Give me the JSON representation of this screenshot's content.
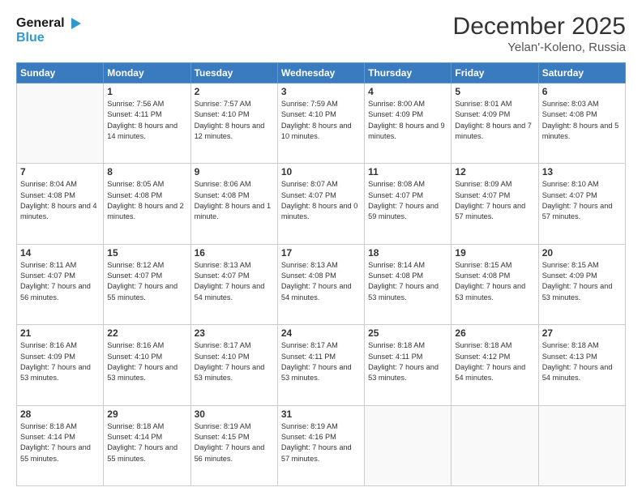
{
  "header": {
    "logo_line1": "General",
    "logo_line2": "Blue",
    "title": "December 2025",
    "location": "Yelan'-Koleno, Russia"
  },
  "weekdays": [
    "Sunday",
    "Monday",
    "Tuesday",
    "Wednesday",
    "Thursday",
    "Friday",
    "Saturday"
  ],
  "weeks": [
    [
      {
        "day": "",
        "empty": true
      },
      {
        "day": "1",
        "sunrise": "Sunrise: 7:56 AM",
        "sunset": "Sunset: 4:11 PM",
        "daylight": "Daylight: 8 hours and 14 minutes."
      },
      {
        "day": "2",
        "sunrise": "Sunrise: 7:57 AM",
        "sunset": "Sunset: 4:10 PM",
        "daylight": "Daylight: 8 hours and 12 minutes."
      },
      {
        "day": "3",
        "sunrise": "Sunrise: 7:59 AM",
        "sunset": "Sunset: 4:10 PM",
        "daylight": "Daylight: 8 hours and 10 minutes."
      },
      {
        "day": "4",
        "sunrise": "Sunrise: 8:00 AM",
        "sunset": "Sunset: 4:09 PM",
        "daylight": "Daylight: 8 hours and 9 minutes."
      },
      {
        "day": "5",
        "sunrise": "Sunrise: 8:01 AM",
        "sunset": "Sunset: 4:09 PM",
        "daylight": "Daylight: 8 hours and 7 minutes."
      },
      {
        "day": "6",
        "sunrise": "Sunrise: 8:03 AM",
        "sunset": "Sunset: 4:08 PM",
        "daylight": "Daylight: 8 hours and 5 minutes."
      }
    ],
    [
      {
        "day": "7",
        "sunrise": "Sunrise: 8:04 AM",
        "sunset": "Sunset: 4:08 PM",
        "daylight": "Daylight: 8 hours and 4 minutes."
      },
      {
        "day": "8",
        "sunrise": "Sunrise: 8:05 AM",
        "sunset": "Sunset: 4:08 PM",
        "daylight": "Daylight: 8 hours and 2 minutes."
      },
      {
        "day": "9",
        "sunrise": "Sunrise: 8:06 AM",
        "sunset": "Sunset: 4:08 PM",
        "daylight": "Daylight: 8 hours and 1 minute."
      },
      {
        "day": "10",
        "sunrise": "Sunrise: 8:07 AM",
        "sunset": "Sunset: 4:07 PM",
        "daylight": "Daylight: 8 hours and 0 minutes."
      },
      {
        "day": "11",
        "sunrise": "Sunrise: 8:08 AM",
        "sunset": "Sunset: 4:07 PM",
        "daylight": "Daylight: 7 hours and 59 minutes."
      },
      {
        "day": "12",
        "sunrise": "Sunrise: 8:09 AM",
        "sunset": "Sunset: 4:07 PM",
        "daylight": "Daylight: 7 hours and 57 minutes."
      },
      {
        "day": "13",
        "sunrise": "Sunrise: 8:10 AM",
        "sunset": "Sunset: 4:07 PM",
        "daylight": "Daylight: 7 hours and 57 minutes."
      }
    ],
    [
      {
        "day": "14",
        "sunrise": "Sunrise: 8:11 AM",
        "sunset": "Sunset: 4:07 PM",
        "daylight": "Daylight: 7 hours and 56 minutes."
      },
      {
        "day": "15",
        "sunrise": "Sunrise: 8:12 AM",
        "sunset": "Sunset: 4:07 PM",
        "daylight": "Daylight: 7 hours and 55 minutes."
      },
      {
        "day": "16",
        "sunrise": "Sunrise: 8:13 AM",
        "sunset": "Sunset: 4:07 PM",
        "daylight": "Daylight: 7 hours and 54 minutes."
      },
      {
        "day": "17",
        "sunrise": "Sunrise: 8:13 AM",
        "sunset": "Sunset: 4:08 PM",
        "daylight": "Daylight: 7 hours and 54 minutes."
      },
      {
        "day": "18",
        "sunrise": "Sunrise: 8:14 AM",
        "sunset": "Sunset: 4:08 PM",
        "daylight": "Daylight: 7 hours and 53 minutes."
      },
      {
        "day": "19",
        "sunrise": "Sunrise: 8:15 AM",
        "sunset": "Sunset: 4:08 PM",
        "daylight": "Daylight: 7 hours and 53 minutes."
      },
      {
        "day": "20",
        "sunrise": "Sunrise: 8:15 AM",
        "sunset": "Sunset: 4:09 PM",
        "daylight": "Daylight: 7 hours and 53 minutes."
      }
    ],
    [
      {
        "day": "21",
        "sunrise": "Sunrise: 8:16 AM",
        "sunset": "Sunset: 4:09 PM",
        "daylight": "Daylight: 7 hours and 53 minutes."
      },
      {
        "day": "22",
        "sunrise": "Sunrise: 8:16 AM",
        "sunset": "Sunset: 4:10 PM",
        "daylight": "Daylight: 7 hours and 53 minutes."
      },
      {
        "day": "23",
        "sunrise": "Sunrise: 8:17 AM",
        "sunset": "Sunset: 4:10 PM",
        "daylight": "Daylight: 7 hours and 53 minutes."
      },
      {
        "day": "24",
        "sunrise": "Sunrise: 8:17 AM",
        "sunset": "Sunset: 4:11 PM",
        "daylight": "Daylight: 7 hours and 53 minutes."
      },
      {
        "day": "25",
        "sunrise": "Sunrise: 8:18 AM",
        "sunset": "Sunset: 4:11 PM",
        "daylight": "Daylight: 7 hours and 53 minutes."
      },
      {
        "day": "26",
        "sunrise": "Sunrise: 8:18 AM",
        "sunset": "Sunset: 4:12 PM",
        "daylight": "Daylight: 7 hours and 54 minutes."
      },
      {
        "day": "27",
        "sunrise": "Sunrise: 8:18 AM",
        "sunset": "Sunset: 4:13 PM",
        "daylight": "Daylight: 7 hours and 54 minutes."
      }
    ],
    [
      {
        "day": "28",
        "sunrise": "Sunrise: 8:18 AM",
        "sunset": "Sunset: 4:14 PM",
        "daylight": "Daylight: 7 hours and 55 minutes."
      },
      {
        "day": "29",
        "sunrise": "Sunrise: 8:18 AM",
        "sunset": "Sunset: 4:14 PM",
        "daylight": "Daylight: 7 hours and 55 minutes."
      },
      {
        "day": "30",
        "sunrise": "Sunrise: 8:19 AM",
        "sunset": "Sunset: 4:15 PM",
        "daylight": "Daylight: 7 hours and 56 minutes."
      },
      {
        "day": "31",
        "sunrise": "Sunrise: 8:19 AM",
        "sunset": "Sunset: 4:16 PM",
        "daylight": "Daylight: 7 hours and 57 minutes."
      },
      {
        "day": "",
        "empty": true
      },
      {
        "day": "",
        "empty": true
      },
      {
        "day": "",
        "empty": true
      }
    ]
  ]
}
